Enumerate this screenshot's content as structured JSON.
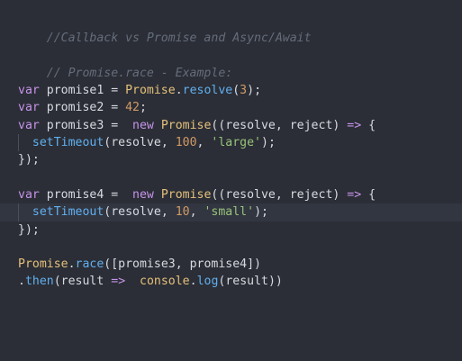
{
  "code": {
    "comment_title": "//Callback vs Promise and Async/Await",
    "comment_example": "// Promise.race - Example:",
    "l1": {
      "kw": "var",
      "name": " promise1 = ",
      "cls": "Promise",
      "dot": ".",
      "fn": "resolve",
      "open": "(",
      "num": "3",
      "close": ");"
    },
    "l2": {
      "kw": "var",
      "name": " promise2 = ",
      "num": "42",
      "close": ";"
    },
    "l3": {
      "kw": "var",
      "name": " promise3 =  ",
      "new": "new",
      "sp": " ",
      "cls": "Promise",
      "args": "((resolve, reject) ",
      "arrow": "=>",
      "brace": " {"
    },
    "l4": {
      "indent": "  ",
      "fn": "setTimeout",
      "open": "(resolve, ",
      "num": "100",
      "comma": ", ",
      "str": "'large'",
      "close": ");"
    },
    "l5": {
      "text": "});"
    },
    "l6": {
      "kw": "var",
      "name": " promise4 =  ",
      "new": "new",
      "sp": " ",
      "cls": "Promise",
      "args": "((resolve, reject) ",
      "arrow": "=>",
      "brace": " {"
    },
    "l7": {
      "indent": "  ",
      "fn": "setTimeout",
      "open": "(resolve, ",
      "num": "10",
      "comma": ", ",
      "str": "'small'",
      "close": ");"
    },
    "l8": {
      "text": "});"
    },
    "l9": {
      "cls": "Promise",
      "dot": ".",
      "fn": "race",
      "args": "([promise3, promise4])"
    },
    "l10": {
      "dot": ".",
      "fn": "then",
      "args": "(result ",
      "arrow": "=>",
      "sp": "  ",
      "obj": "console",
      "dot2": ".",
      "fn2": "log",
      "close": "(result))"
    }
  }
}
